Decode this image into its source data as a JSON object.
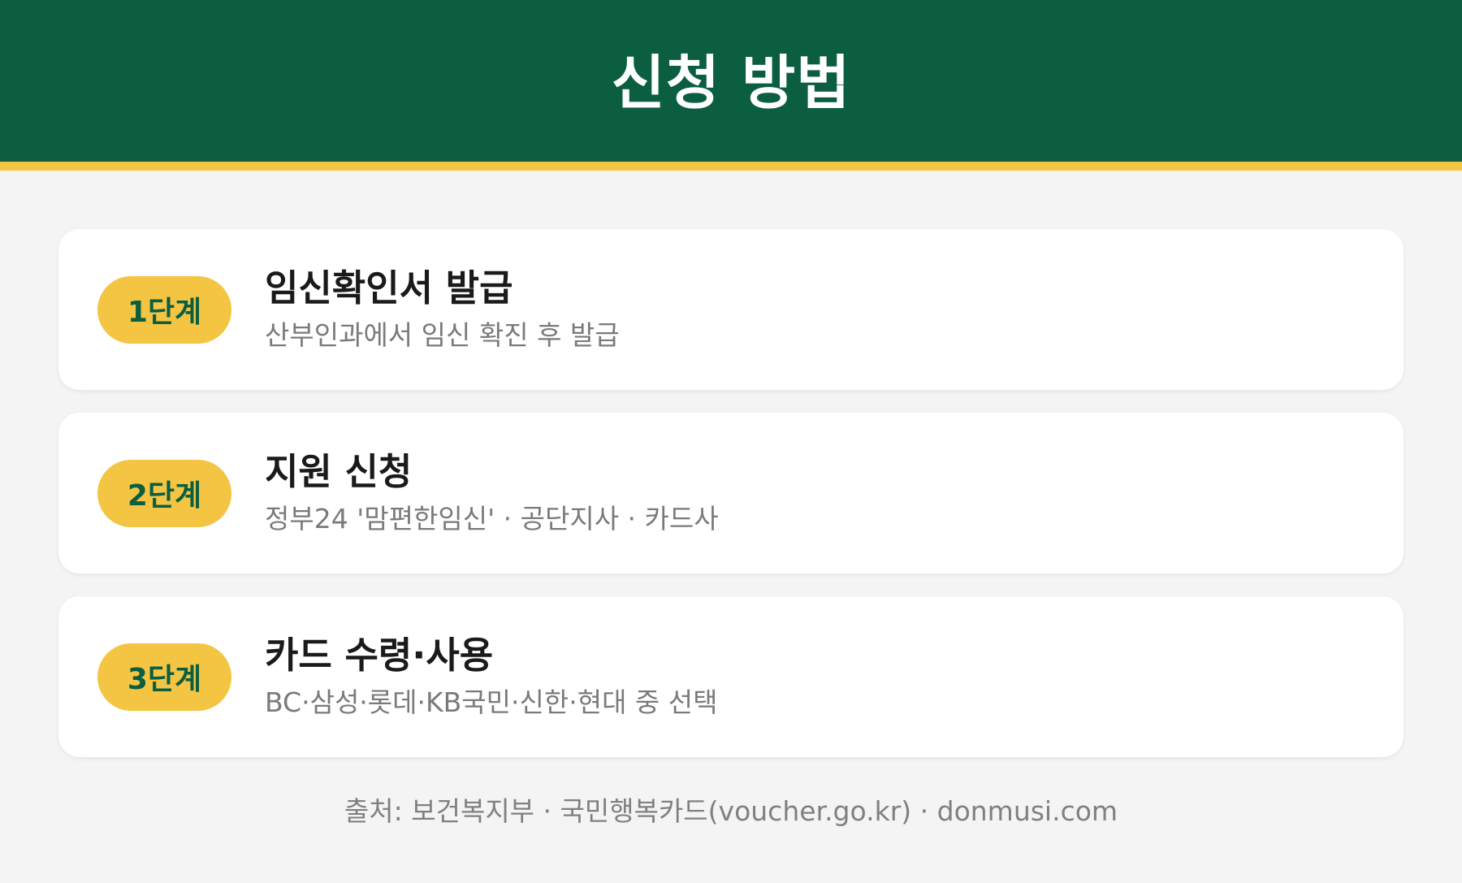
{
  "header": {
    "title": "신청 방법"
  },
  "steps": [
    {
      "badge": "1단계",
      "title": "임신확인서 발급",
      "desc": "산부인과에서 임신 확진 후 발급"
    },
    {
      "badge": "2단계",
      "title": "지원 신청",
      "desc": "정부24 '맘편한임신' · 공단지사 · 카드사"
    },
    {
      "badge": "3단계",
      "title": "카드 수령·사용",
      "desc": "BC·삼성·롯데·KB국민·신한·현대 중 선택"
    }
  ],
  "footer": {
    "source": "출처: 보건복지부 · 국민행복카드(voucher.go.kr) · donmusi.com"
  },
  "colors": {
    "header_bg": "#0b5e40",
    "accent": "#f4c542",
    "page_bg": "#f3f4f3"
  }
}
